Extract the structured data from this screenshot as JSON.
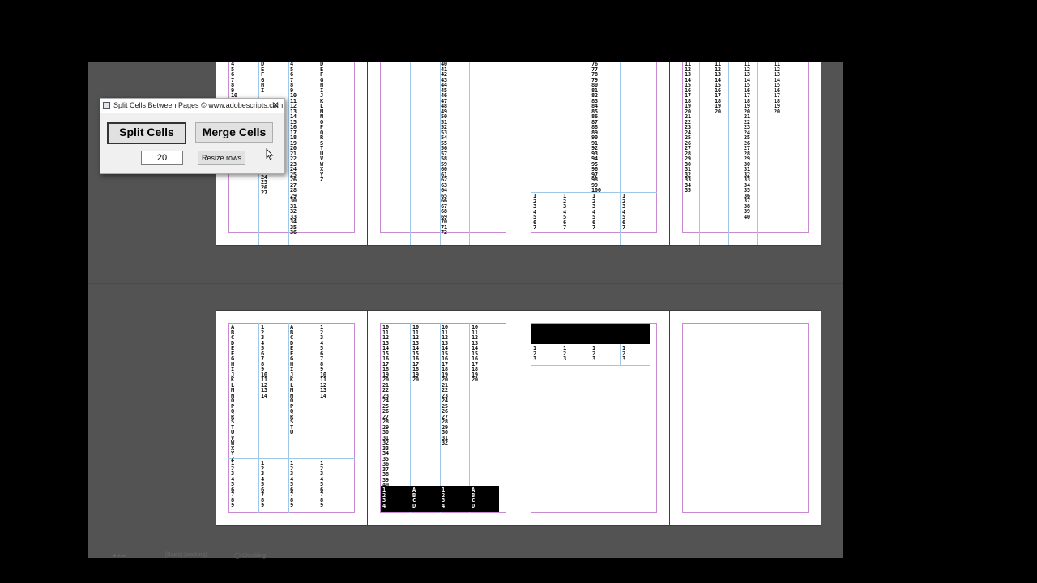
{
  "dialog": {
    "title": "Split Cells Between Pages © www.adobescripts.com",
    "close_glyph": "✕",
    "split_label": "Split Cells",
    "merge_label": "Merge Cells",
    "rows_value": "20",
    "resize_label": "Resize rows"
  },
  "statusbar": {
    "page_nav": "◄  ▸  ▸|",
    "master": "[Basic] (working)",
    "preflight": "◯ Checking"
  },
  "pages": {
    "p1_cols": [
      "4\n5\n6\n7\n8\n9\n10",
      "D\nE\nF\nG\nH\nI",
      "4\n5\n6\n7\n8\n9\n10\n11\n12\n13\n14\n15\n16\n17\n18\n19\n20\n21\n22\n23\n24\n25\n26\n27\n28\n29\n30\n31\n32\n33\n34\n35\n36",
      "D\nE\nF\nG\nH\nI\nJ\nK\nL\nM\nN\nO\nP\nQ\nR\nS\nT\nU\nV\nW\nX\nY\nZ"
    ],
    "p1_extra": "21\n22\n23\n24\n25\n26\n27",
    "p2_col": "40\n41\n42\n43\n44\n45\n46\n47\n48\n49\n50\n51\n52\n53\n54\n55\n56\n57\n58\n59\n60\n61\n62\n63\n64\n65\n66\n67\n68\n69\n70\n71\n72",
    "p3_col": "76\n77\n78\n79\n80\n81\n82\n83\n84\n85\n86\n87\n88\n89\n90\n91\n92\n93\n94\n95\n96\n97\n98\n99\n100",
    "p3_bottom": "1\n2\n3\n4\n5\n6\n7",
    "p4_cols": [
      "11\n12\n13\n14\n15\n16\n17\n18\n19\n20\n21\n22\n23\n24\n25\n26\n27\n28\n29\n30\n31\n32\n33\n34\n35",
      "11\n12\n13\n14\n15\n16\n17\n18\n19\n20",
      "11\n12\n13\n14\n15\n16\n17\n18\n19\n20\n21\n22\n23\n24\n25\n26\n27\n28\n29\n30\n31\n32\n33\n34\n35\n36\n37\n38\n39\n40",
      "11\n12\n13\n14\n15\n16\n17\n18\n19\n20"
    ],
    "p5_cols": [
      "A\nB\nC\nD\nE\nF\nG\nH\nI\nJ\nK\nL\nM\nN\nO\nP\nQ\nR\nS\nT\nU\nV\nW\nX\nY\nZ",
      "1\n2\n3\n4\n5\n6\n7\n8\n9\n10\n11\n12\n13\n14",
      "A\nB\nC\nD\nE\nF\nG\nH\nI\nJ\nK\nL\nM\nN\nO\nP\nQ\nR\nS\nT\nU",
      "1\n2\n3\n4\n5\n6\n7\n8\n9\n10\n11\n12\n13\n14"
    ],
    "p5_bottom": "1\n2\n3\n4\n5\n6\n7\n8\n9",
    "p6_cols": [
      "10\n11\n12\n13\n14\n15\n16\n17\n18\n19\n20\n21\n22\n23\n24\n25\n26\n27\n28\n29\n30\n31\n32\n33\n34\n35\n36\n37\n38\n39\n40",
      "10\n11\n12\n13\n14\n15\n16\n17\n18\n19\n20",
      "10\n11\n12\n13\n14\n15\n16\n17\n18\n19\n20\n21\n22\n23\n24\n25\n26\n27\n28\n29\n30\n31\n32",
      "10\n11\n12\n13\n14\n15\n16\n17\n18\n19\n20"
    ],
    "p6_black": [
      "1\n2\n3\n4",
      "A\nB\nC\nD",
      "1\n2\n3\n4",
      "A\nB\nC\nD"
    ],
    "p7_cols": "1\n2\n3"
  }
}
